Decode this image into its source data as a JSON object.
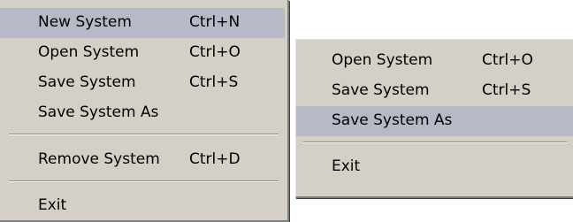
{
  "menu_left": {
    "items": [
      {
        "label": "New System",
        "shortcut": "Ctrl+N",
        "highlighted": true
      },
      {
        "label": "Open System",
        "shortcut": "Ctrl+O"
      },
      {
        "label": "Save System",
        "shortcut": "Ctrl+S"
      },
      {
        "label": "Save System As",
        "shortcut": ""
      },
      {
        "label": "Remove System",
        "shortcut": "Ctrl+D"
      },
      {
        "label": "Exit",
        "shortcut": ""
      }
    ]
  },
  "menu_right": {
    "items": [
      {
        "label": "Open System",
        "shortcut": "Ctrl+O"
      },
      {
        "label": "Save System",
        "shortcut": "Ctrl+S"
      },
      {
        "label": "Save System As",
        "shortcut": "",
        "highlighted": true
      },
      {
        "label": "Exit",
        "shortcut": ""
      }
    ]
  },
  "colors": {
    "menu_background": "#d4d0c8",
    "highlight": "#b8b9c7"
  }
}
